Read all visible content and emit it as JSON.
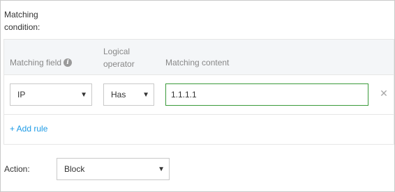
{
  "condition": {
    "label": "Matching condition:"
  },
  "rule_table": {
    "headers": {
      "field": "Matching field",
      "operator": "Logical operator",
      "content": "Matching content"
    },
    "rows": [
      {
        "field": "IP",
        "operator": "Has",
        "content": "1.1.1.1"
      }
    ],
    "add_rule_label": "+ Add rule"
  },
  "action": {
    "label": "Action:",
    "value": "Block"
  },
  "icons": {
    "info": "info-icon",
    "delete": "close-icon",
    "caret": "caret-down-icon"
  },
  "colors": {
    "link": "#1e9be6",
    "input_focus_border": "#3a9a3a",
    "header_bg": "#f4f6f8"
  }
}
